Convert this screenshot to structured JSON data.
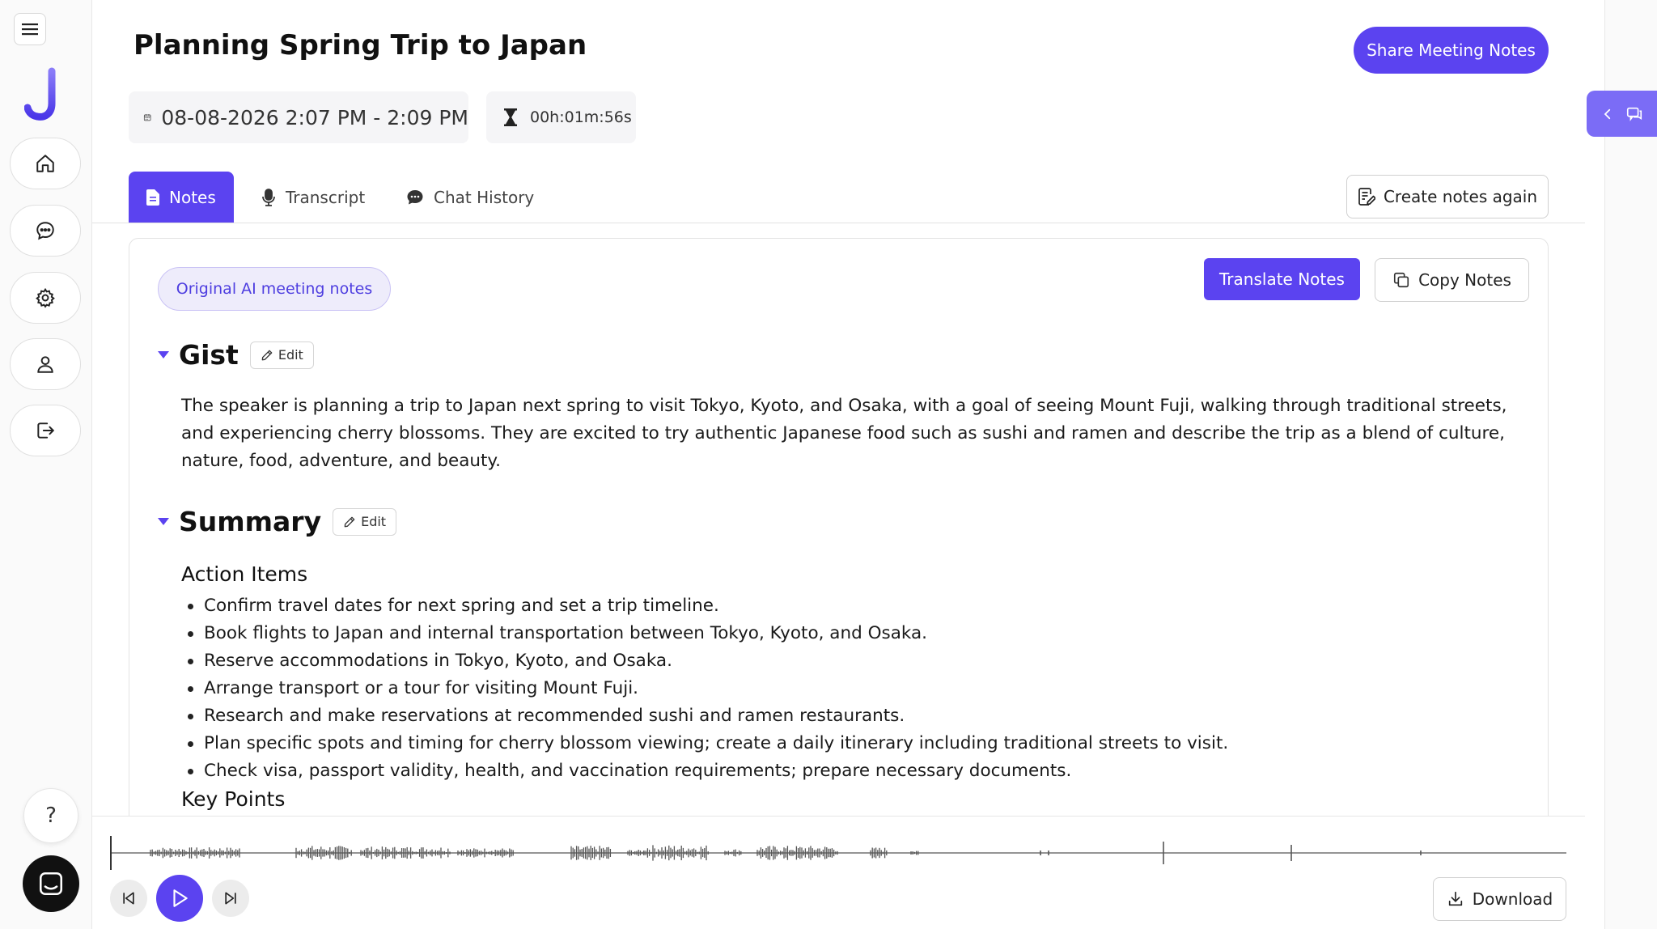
{
  "sidebar": {
    "logo_letter": "J",
    "nav": [
      {
        "name": "home",
        "icon": "home-icon"
      },
      {
        "name": "chat",
        "icon": "chat-bubble-icon"
      },
      {
        "name": "settings",
        "icon": "gear-icon"
      },
      {
        "name": "profile",
        "icon": "user-icon"
      },
      {
        "name": "logout",
        "icon": "logout-icon"
      }
    ],
    "help_label": "?"
  },
  "header": {
    "title": "Planning Spring Trip to Japan",
    "share_label": "Share Meeting Notes",
    "datetime": "08-08-2026 2:07 PM - 2:09 PM",
    "duration": "00h:01m:56s"
  },
  "tabs": [
    {
      "label": "Notes",
      "active": true
    },
    {
      "label": "Transcript",
      "active": false
    },
    {
      "label": "Chat History",
      "active": false
    }
  ],
  "create_notes_label": "Create notes again",
  "notes": {
    "original_label": "Original AI meeting notes",
    "translate_label": "Translate Notes",
    "copy_label": "Copy Notes",
    "edit_label": "Edit",
    "gist": {
      "title": "Gist",
      "text": "The speaker is planning a trip to Japan next spring to visit Tokyo, Kyoto, and Osaka, with a goal of seeing Mount Fuji, walking through traditional streets, and experiencing cherry blossoms. They are excited to try authentic Japanese food such as sushi and ramen and describe the trip as a blend of culture, nature, food, adventure, and beauty."
    },
    "summary": {
      "title": "Summary",
      "action_items_title": "Action Items",
      "action_items": [
        "Confirm travel dates for next spring and set a trip timeline.",
        "Book flights to Japan and internal transportation between Tokyo, Kyoto, and Osaka.",
        "Reserve accommodations in Tokyo, Kyoto, and Osaka.",
        "Arrange transport or a tour for visiting Mount Fuji.",
        "Research and make reservations at recommended sushi and ramen restaurants.",
        "Plan specific spots and timing for cherry blossom viewing; create a daily itinerary including traditional streets to visit.",
        "Check visa, passport validity, health, and vaccination requirements; prepare necessary documents."
      ],
      "key_points_title": "Key Points"
    }
  },
  "player": {
    "download_label": "Download"
  },
  "colors": {
    "accent": "#5b43f0",
    "accent_light": "#eeecfb",
    "rail_toggle": "#7b6cf6"
  }
}
